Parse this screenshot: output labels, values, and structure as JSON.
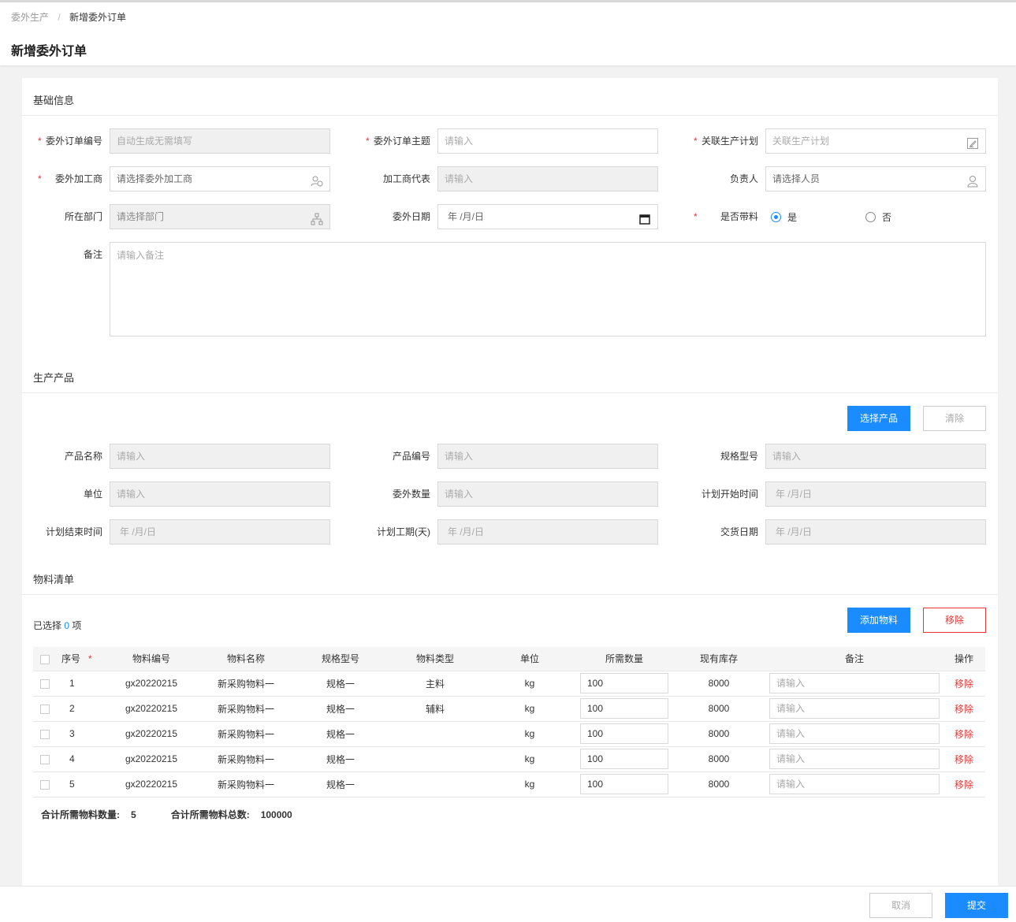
{
  "breadcrumb": {
    "parent": "委外生产",
    "separator": "/",
    "current": "新增委外订单"
  },
  "page_title": "新增委外订单",
  "sections": {
    "basic": "基础信息",
    "product": "生产产品",
    "materials": "物料清单"
  },
  "basic": {
    "order_no": {
      "label": "委外订单编号",
      "placeholder": "自动生成无需填写"
    },
    "order_subject": {
      "label": "委外订单主题",
      "placeholder": "请输入"
    },
    "production_plan": {
      "label": "关联生产计划",
      "placeholder": "关联生产计划"
    },
    "processor": {
      "label": "委外加工商",
      "placeholder": "请选择委外加工商"
    },
    "processor_rep": {
      "label": "加工商代表",
      "placeholder": "请输入"
    },
    "owner": {
      "label": "负责人",
      "placeholder": "请选择人员"
    },
    "department": {
      "label": "所在部门",
      "placeholder": "请选择部门"
    },
    "date": {
      "label": "委外日期",
      "placeholder": "年 /月/日"
    },
    "with_material": {
      "label": "是否带料",
      "yes": "是",
      "no": "否",
      "selected": "是"
    },
    "remark": {
      "label": "备注",
      "placeholder": "请输入备注"
    }
  },
  "product": {
    "select_button": "选择产品",
    "clear_button": "清除",
    "name": {
      "label": "产品名称",
      "placeholder": "请输入"
    },
    "code": {
      "label": "产品编号",
      "placeholder": "请输入"
    },
    "spec": {
      "label": "规格型号",
      "placeholder": "请输入"
    },
    "unit": {
      "label": "单位",
      "placeholder": "请输入"
    },
    "qty": {
      "label": "委外数量",
      "placeholder": "请输入"
    },
    "plan_start": {
      "label": "计划开始时间",
      "placeholder": "年 /月/日"
    },
    "plan_end": {
      "label": "计划结束时间",
      "placeholder": "年 /月/日"
    },
    "plan_days": {
      "label": "计划工期(天)",
      "placeholder": "年 /月/日"
    },
    "delivery": {
      "label": "交货日期",
      "placeholder": "年 /月/日"
    }
  },
  "materials": {
    "selected_prefix": "已选择",
    "selected_count": "0",
    "selected_suffix": "项",
    "add_button": "添加物料",
    "remove_button": "移除",
    "columns": [
      "序号",
      "物料编号",
      "物料名称",
      "规格型号",
      "物料类型",
      "单位",
      "所需数量",
      "现有库存",
      "备注",
      "操作"
    ],
    "required_mark": "*",
    "remark_placeholder": "请输入",
    "row_action": "移除",
    "rows": [
      {
        "seq": "1",
        "code": "gx20220215",
        "name": "新采购物料一",
        "spec": "规格一",
        "type": "主料",
        "unit": "kg",
        "qty": "100",
        "stock": "8000"
      },
      {
        "seq": "2",
        "code": "gx20220215",
        "name": "新采购物料一",
        "spec": "规格一",
        "type": "辅料",
        "unit": "kg",
        "qty": "100",
        "stock": "8000"
      },
      {
        "seq": "3",
        "code": "gx20220215",
        "name": "新采购物料一",
        "spec": "规格一",
        "type": "",
        "unit": "kg",
        "qty": "100",
        "stock": "8000"
      },
      {
        "seq": "4",
        "code": "gx20220215",
        "name": "新采购物料一",
        "spec": "规格一",
        "type": "",
        "unit": "kg",
        "qty": "100",
        "stock": "8000"
      },
      {
        "seq": "5",
        "code": "gx20220215",
        "name": "新采购物料一",
        "spec": "规格一",
        "type": "",
        "unit": "kg",
        "qty": "100",
        "stock": "8000"
      }
    ],
    "total_count_label": "合计所需物料数量:",
    "total_count": "5",
    "total_sum_label": "合计所需物料总数:",
    "total_sum": "100000"
  },
  "footer": {
    "cancel": "取消",
    "submit": "提交"
  },
  "colors": {
    "accent": "#1a8cff",
    "danger": "#e33333",
    "required": "#e33333"
  },
  "icons": [
    "edit-icon",
    "user-group-icon",
    "user-icon",
    "org-chart-icon",
    "calendar-icon"
  ]
}
